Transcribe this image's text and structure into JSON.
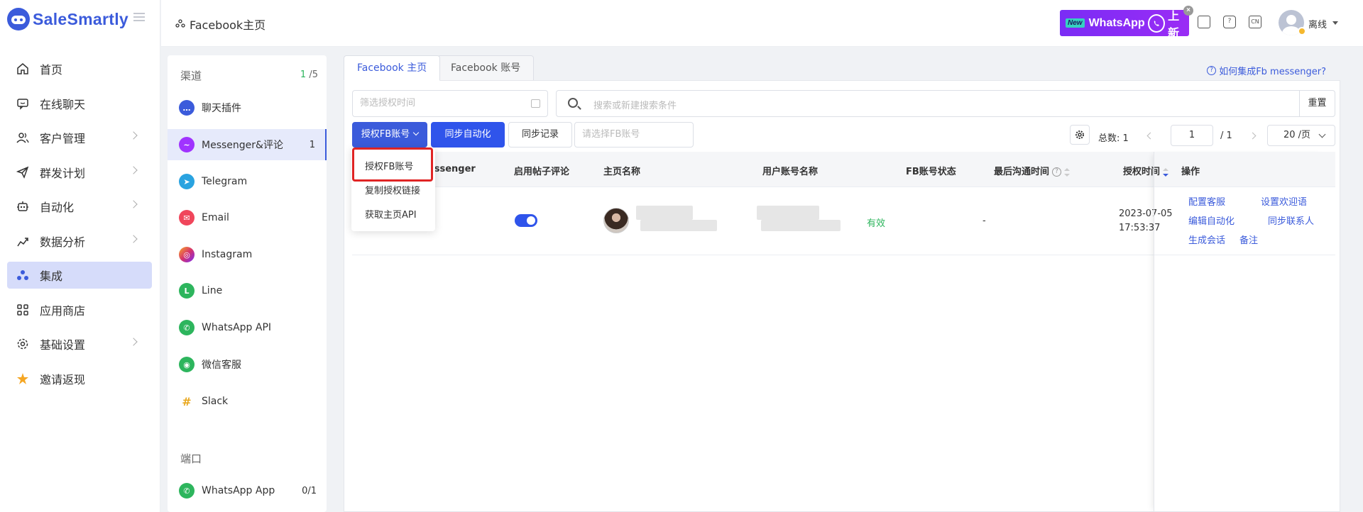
{
  "app": {
    "name": "SaleSmartly"
  },
  "nav": {
    "items": [
      {
        "label": "首页",
        "icon": "home-icon"
      },
      {
        "label": "在线聊天",
        "icon": "chat-icon"
      },
      {
        "label": "客户管理",
        "icon": "users-icon"
      },
      {
        "label": "群发计划",
        "icon": "send-icon"
      },
      {
        "label": "自动化",
        "icon": "robot-icon"
      },
      {
        "label": "数据分析",
        "icon": "chart-icon"
      },
      {
        "label": "集成",
        "icon": "integration-icon",
        "active": true
      },
      {
        "label": "应用商店",
        "icon": "apps-icon"
      },
      {
        "label": "基础设置",
        "icon": "settings-icon"
      },
      {
        "label": "邀请返现",
        "icon": "star-icon"
      }
    ]
  },
  "header": {
    "title": "Facebook主页",
    "banner": {
      "new": "New",
      "brand": "WhatsApp",
      "suffix": "上新",
      "close": "×"
    },
    "icons": [
      "book-icon",
      "help-icon",
      "language-icon"
    ],
    "language_label": "CN",
    "help_label": "?",
    "status": "离线"
  },
  "channels": {
    "section_title": "渠道",
    "count_used": "1",
    "count_total": "/5",
    "items": [
      {
        "label": "聊天插件",
        "icon": "chat-plugin-icon",
        "color": "#3b5bdb",
        "glyph": "…"
      },
      {
        "label": "Messenger&评论",
        "icon": "messenger-icon",
        "color": "#a033ff",
        "glyph": "~",
        "count": "1"
      },
      {
        "label": "Telegram",
        "icon": "telegram-icon",
        "color": "#2aa3e0",
        "glyph": "➤"
      },
      {
        "label": "Email",
        "icon": "email-icon",
        "color": "#f0465b",
        "glyph": "✉"
      },
      {
        "label": "Instagram",
        "icon": "instagram-icon",
        "color": "#d6336c",
        "glyph": "◎"
      },
      {
        "label": "Line",
        "icon": "line-icon",
        "color": "#2db55d",
        "glyph": "L"
      },
      {
        "label": "WhatsApp API",
        "icon": "whatsapp-api-icon",
        "color": "#2db55d",
        "glyph": "✆"
      },
      {
        "label": "微信客服",
        "icon": "wechat-icon",
        "color": "#2db55d",
        "glyph": "◉"
      },
      {
        "label": "Slack",
        "icon": "slack-icon",
        "color": "#e9a820",
        "glyph": "#"
      }
    ],
    "port_title": "端口",
    "port_items": [
      {
        "label": "WhatsApp App",
        "icon": "whatsapp-app-icon",
        "color": "#2db55d",
        "glyph": "✆",
        "count": "0/1"
      }
    ]
  },
  "tabs": [
    {
      "label": "Facebook 主页",
      "active": true
    },
    {
      "label": "Facebook 账号"
    }
  ],
  "help_link": "如何集成Fb messenger?",
  "filters": {
    "date_placeholder": "筛选授权时间",
    "search_placeholder": "搜索或新建搜索条件",
    "reset": "重置"
  },
  "actions": {
    "auth": "授权FB账号",
    "sync": "同步自动化",
    "record": "同步记录",
    "select_placeholder": "请选择FB账号"
  },
  "pagination": {
    "total_label": "总数:",
    "total": "1",
    "current": "1",
    "of": "/ 1",
    "page_size": "20 /页"
  },
  "table": {
    "columns": [
      "Messenger",
      "启用帖子评论",
      "主页名称",
      "用户账号名称",
      "FB账号状态",
      "最后沟通时间",
      "授权时间",
      "操作"
    ],
    "rows": [
      {
        "status": "有效",
        "last_contact": "-",
        "auth_date": "2023-07-05",
        "auth_time": "17:53:37",
        "ops": [
          "配置客服",
          "设置欢迎语",
          "编辑自动化",
          "同步联系人",
          "生成会话",
          "备注"
        ]
      }
    ]
  },
  "dropdown": {
    "items": [
      "授权FB账号",
      "复制授权链接",
      "获取主页API"
    ]
  }
}
